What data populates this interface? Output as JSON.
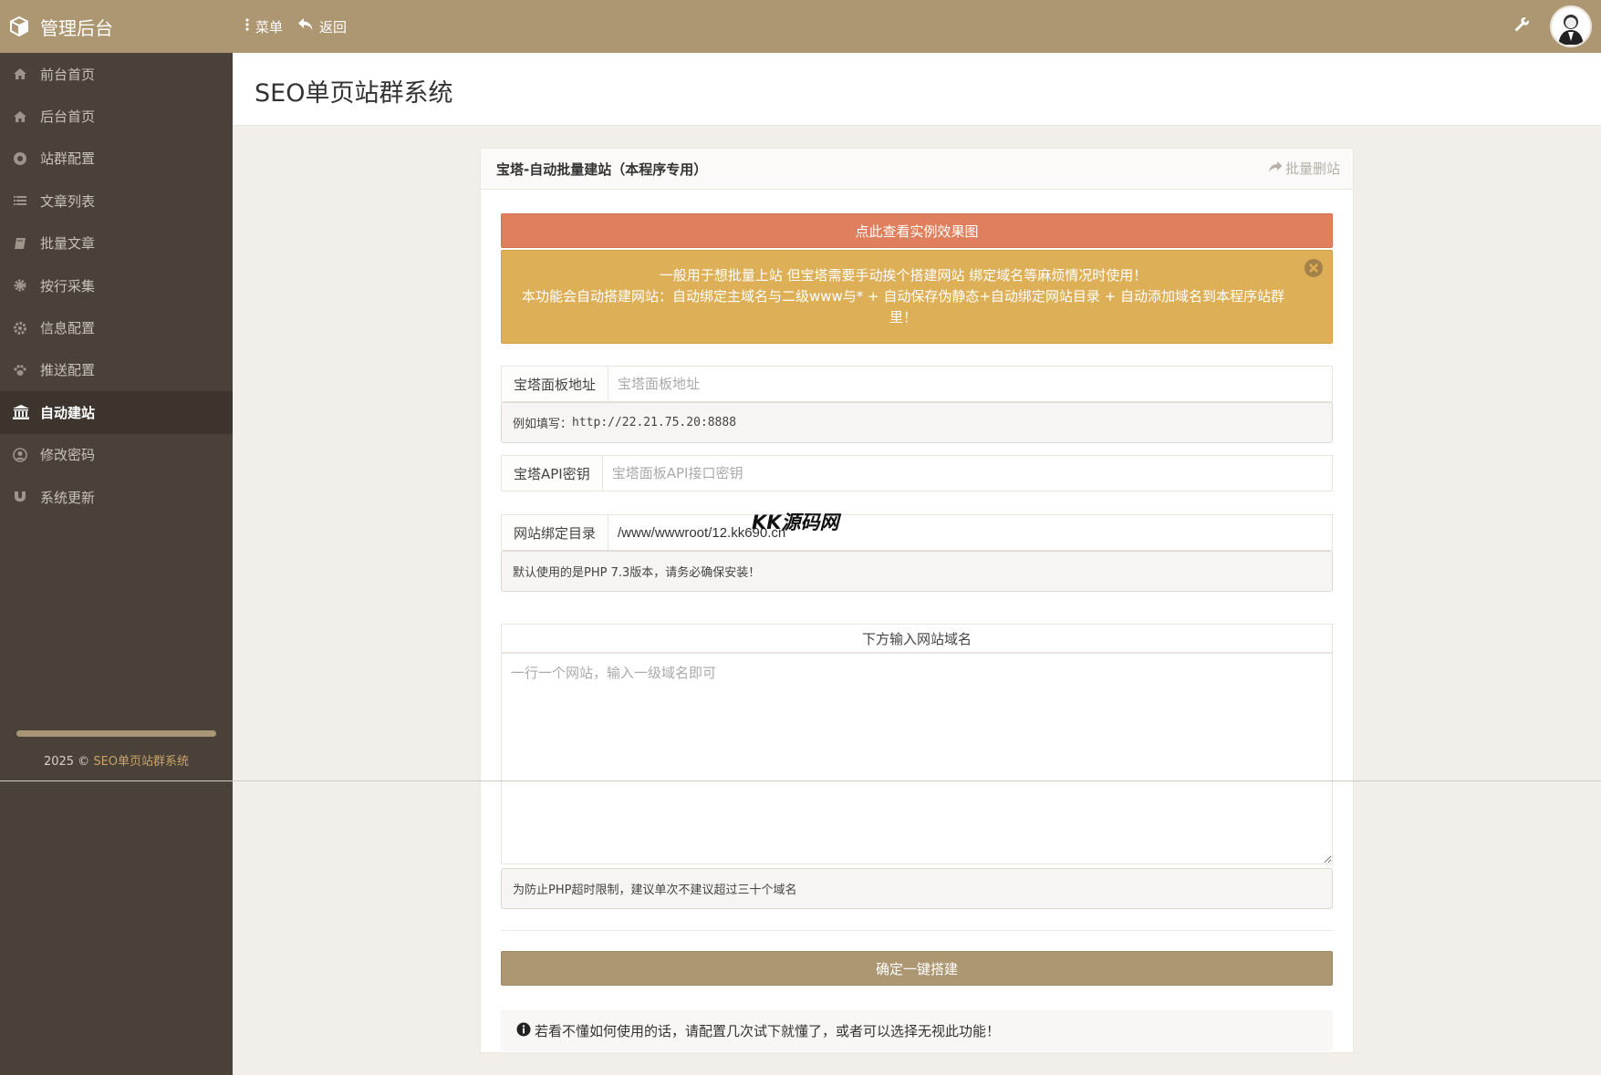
{
  "topbar": {
    "brand": "管理后台",
    "menu_label": "菜单",
    "back_label": "返回"
  },
  "sidebar": {
    "items": [
      {
        "label": "前台首页",
        "icon": "home-icon"
      },
      {
        "label": "后台首页",
        "icon": "home-icon"
      },
      {
        "label": "站群配置",
        "icon": "chrome-icon"
      },
      {
        "label": "文章列表",
        "icon": "list-icon"
      },
      {
        "label": "批量文章",
        "icon": "book-icon"
      },
      {
        "label": "按行采集",
        "icon": "gear-icon"
      },
      {
        "label": "信息配置",
        "icon": "cog-icon"
      },
      {
        "label": "推送配置",
        "icon": "paw-icon"
      },
      {
        "label": "自动建站",
        "icon": "bank-icon",
        "active": true
      },
      {
        "label": "修改密码",
        "icon": "user-circle-icon"
      },
      {
        "label": "系统更新",
        "icon": "magnet-icon"
      }
    ],
    "footer_prefix": "2025 © ",
    "footer_highlight": "SEO单页站群系统"
  },
  "page": {
    "title": "SEO单页站群系统"
  },
  "panel": {
    "title": "宝塔-自动批量建站（本程序专用）",
    "header_link": "批量删站",
    "demo_button": "点此查看实例效果图",
    "alert_line1": "一般用于想批量上站 但宝塔需要手动挨个搭建网站 绑定域名等麻烦情况时使用！",
    "alert_line2": "本功能会自动搭建网站：自动绑定主域名与二级www与* + 自动保存伪静态+自动绑定网站目录 + 自动添加域名到本程序站群里！",
    "panel_url": {
      "label": "宝塔面板地址",
      "placeholder": "宝塔面板地址",
      "value": ""
    },
    "panel_url_help_prefix": "例如填写：",
    "panel_url_help_example": "http://22.21.75.20:8888",
    "api_key": {
      "label": "宝塔API密钥",
      "placeholder": "宝塔面板API接口密钥",
      "value": ""
    },
    "site_dir": {
      "label": "网站绑定目录",
      "value": "/www/wwwroot/12.kk690.cn"
    },
    "site_dir_help": "默认使用的是PHP 7.3版本，请务必确保安装！",
    "domain_header": "下方输入网站域名",
    "domain_placeholder": "一行一个网站，输入一级域名即可",
    "domain_help": "为防止PHP超时限制，建议单次不建议超过三十个域名",
    "submit_button": "确定一键搭建",
    "tip": "若看不懂如何使用的话，请配置几次试下就懂了，或者可以选择无视此功能！"
  },
  "watermark": "KK源码网",
  "colors": {
    "topbar": "#ad9672",
    "sidebar": "#4a4139",
    "demo_button": "#e07f5e",
    "alert": "#ddb058",
    "submit_button": "#ad9672"
  }
}
